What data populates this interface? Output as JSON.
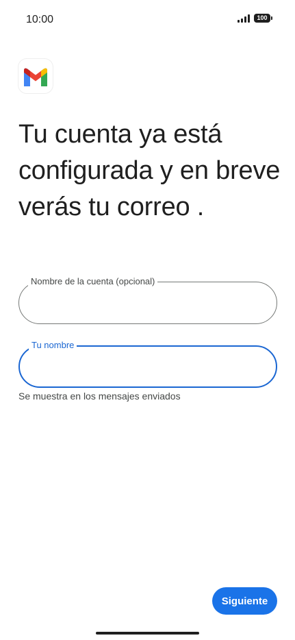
{
  "status_bar": {
    "time": "10:00",
    "battery": "100",
    "icons": [
      "signal-icon",
      "battery-icon"
    ]
  },
  "logo": {
    "icon": "gmail-icon",
    "colors": [
      "#4285f4",
      "#ea4335",
      "#fbbc04",
      "#34a853",
      "#c5221f"
    ]
  },
  "heading": "Tu cuenta ya está configurada y en breve verás tu correo .",
  "account_name_field": {
    "label": "Nombre de la cuenta (opcional)",
    "value": ""
  },
  "your_name_field": {
    "label": "Tu nombre",
    "value": "",
    "helper": "Se muestra en los mensajes enviados",
    "focused": true
  },
  "next_button": {
    "label": "Siguiente"
  },
  "colors": {
    "accent": "#1a73e8",
    "focus_outline": "#1a66d2",
    "outline": "#747775",
    "text": "#1f1f1f"
  }
}
